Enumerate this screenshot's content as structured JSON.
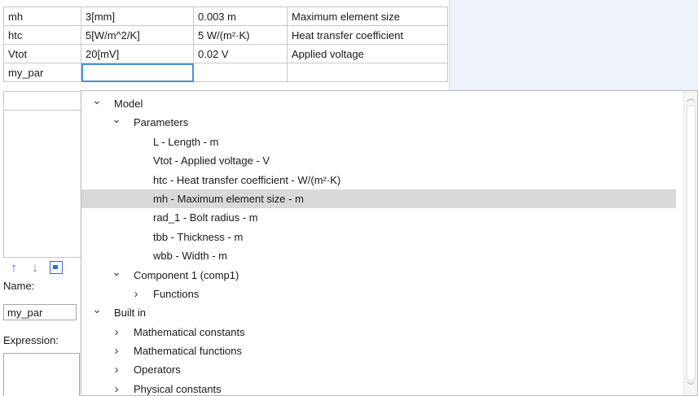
{
  "parameters_table": {
    "rows": [
      {
        "name": "mh",
        "expression": "3[mm]",
        "value": "0.003 m",
        "description": "Maximum element size"
      },
      {
        "name": "htc",
        "expression": "5[W/m^2/K]",
        "value": "5 W/(m²·K)",
        "description": "Heat transfer coefficient"
      },
      {
        "name": "Vtot",
        "expression": "20[mV]",
        "value": "0.02 V",
        "description": "Applied voltage"
      },
      {
        "name": "my_par",
        "expression": "",
        "value": "",
        "description": ""
      }
    ]
  },
  "settings": {
    "name_label": "Name:",
    "name_value": "my_par",
    "expression_label": "Expression:",
    "toolbar_icons": [
      "move-up-icon",
      "move-down-icon",
      "insert-expression-icon"
    ]
  },
  "dropdown": {
    "items": [
      {
        "label": "Model",
        "expanded": true,
        "level": 0,
        "has_children": true
      },
      {
        "label": "Parameters",
        "expanded": true,
        "level": 1,
        "has_children": true
      },
      {
        "label": "L - Length - m",
        "level": 2,
        "has_children": false
      },
      {
        "label": "Vtot - Applied voltage - V",
        "level": 2,
        "has_children": false
      },
      {
        "label": "htc - Heat transfer coefficient - W/(m²·K)",
        "level": 2,
        "has_children": false
      },
      {
        "label": "mh - Maximum element size - m",
        "level": 2,
        "has_children": false,
        "selected": true
      },
      {
        "label": "rad_1 - Bolt radius - m",
        "level": 2,
        "has_children": false
      },
      {
        "label": "tbb - Thickness - m",
        "level": 2,
        "has_children": false
      },
      {
        "label": "wbb - Width - m",
        "level": 2,
        "has_children": false
      },
      {
        "label": "Component 1 (comp1)",
        "expanded": true,
        "level": 1,
        "has_children": true
      },
      {
        "label": "Functions",
        "expanded": false,
        "level": 2,
        "has_children": true
      },
      {
        "label": "Built in",
        "expanded": true,
        "level": 0,
        "has_children": true
      },
      {
        "label": "Mathematical constants",
        "expanded": false,
        "level": 1,
        "has_children": true
      },
      {
        "label": "Mathematical functions",
        "expanded": false,
        "level": 1,
        "has_children": true
      },
      {
        "label": "Operators",
        "expanded": false,
        "level": 1,
        "has_children": true
      },
      {
        "label": "Physical constants",
        "expanded": false,
        "level": 1,
        "has_children": true
      }
    ]
  },
  "colors": {
    "selection": "#d9d9d9",
    "accent": "#2a6fc9",
    "right_pane": "#eef3fb"
  }
}
